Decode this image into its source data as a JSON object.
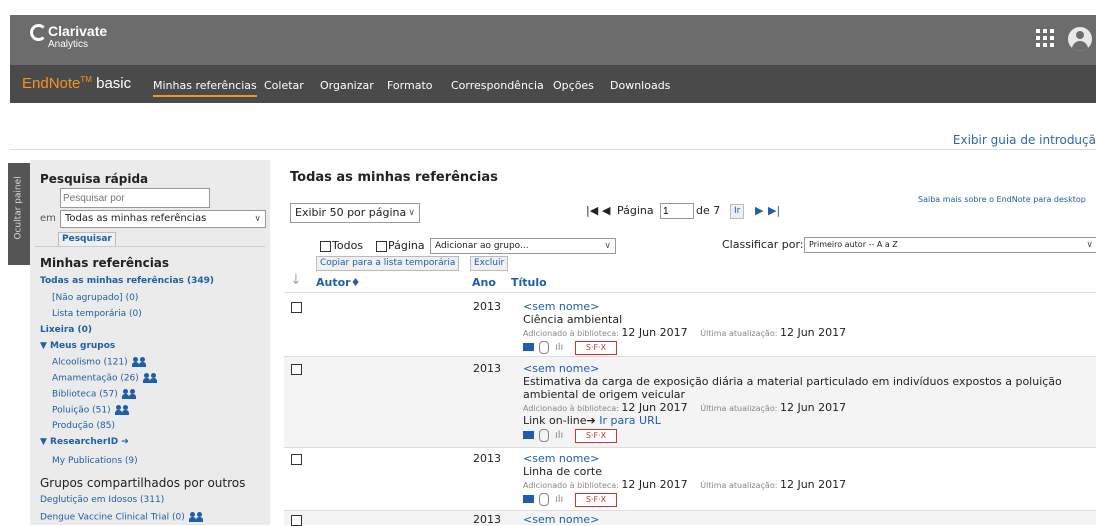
{
  "header": {
    "logo_name": "Clarivate",
    "logo_sub": "Analytics",
    "grid_icon": "apps-grid-icon",
    "user_icon": "user-avatar-icon"
  },
  "nav": {
    "brand_en": "EndNote",
    "brand_tm": "TM",
    "brand_basic": "basic",
    "items": [
      "Minhas referências",
      "Coletar",
      "Organizar",
      "Formato",
      "Correspondência",
      "Opções",
      "Downloads"
    ],
    "active_color": "#f7941d"
  },
  "guide_link": "Exibir guia de introduçã",
  "side_tab": "Ocultar painel",
  "sidebar": {
    "quick_search_title": "Pesquisa rápida",
    "search_placeholder": "Pesquisar por",
    "in_label": "em",
    "in_select": "Todas as minhas referências",
    "search_button": "Pesquisar",
    "my_refs_title": "Minhas referências",
    "all_refs": "Todas as minhas referências (349)",
    "unfiled": "[Não agrupado] (0)",
    "temp_list": "Lista temporária (0)",
    "trash": "Lixeira (0)",
    "my_groups": "▼ Meus grupos",
    "groups": [
      "Alcoolismo (121)",
      "Amamentação (26)",
      "Biblioteca (57)",
      "Poluição (51)",
      "Produção (85)"
    ],
    "researcher": "▼ ResearcherID ➔",
    "my_publications": "My Publications (9)",
    "shared_title": "Grupos compartilhados por outros",
    "shared": [
      "Deglutição em Idosos (311)",
      "Dengue Vaccine Clinical Trial (0)"
    ]
  },
  "main": {
    "title": "Todas as minhas referências",
    "per_page": "Exibir 50 por página",
    "page_label": "Página",
    "page_value": "1",
    "of_pages": "de 7",
    "go_button": "Ir",
    "desktop_link": "Saiba mais sobre o EndNote para desktop",
    "all_label": "Todos",
    "page_check_label": "Página",
    "add_group": "Adicionar ao grupo...",
    "sort_label": "Classificar por:",
    "sort_value": "Primeiro autor -- A a Z",
    "copy_button": "Copiar para a lista temporária",
    "delete_button": "Excluir",
    "col_author": "Autor♦",
    "col_year": "Ano",
    "col_title": "Título"
  },
  "records": [
    {
      "year": "2013",
      "name": "<sem nome>",
      "title": "Ciência ambiental",
      "added_label": "Adicionado à biblioteca:",
      "added": "12 Jun 2017",
      "updated_label": "Última atualização:",
      "updated": "12 Jun 2017",
      "sfx": "S·F·X"
    },
    {
      "year": "2013",
      "name": "<sem nome>",
      "title": "Estimativa da carga de exposição diária a material particulado em indivíduos expostos a poluição",
      "title2": "ambiental de origem veicular",
      "added_label": "Adicionado à biblioteca:",
      "added": "12 Jun 2017",
      "updated_label": "Última atualização:",
      "updated": "12 Jun 2017",
      "link_label": "Link on-line",
      "link_go": "Ir para URL",
      "sfx": "S·F·X"
    },
    {
      "year": "2013",
      "name": "<sem nome>",
      "title": "Linha de corte",
      "added_label": "Adicionado à biblioteca:",
      "added": "12 Jun 2017",
      "updated_label": "Última atualização:",
      "updated": "12 Jun 2017",
      "sfx": "S·F·X"
    },
    {
      "year": "2013",
      "name": "<sem nome>"
    }
  ]
}
